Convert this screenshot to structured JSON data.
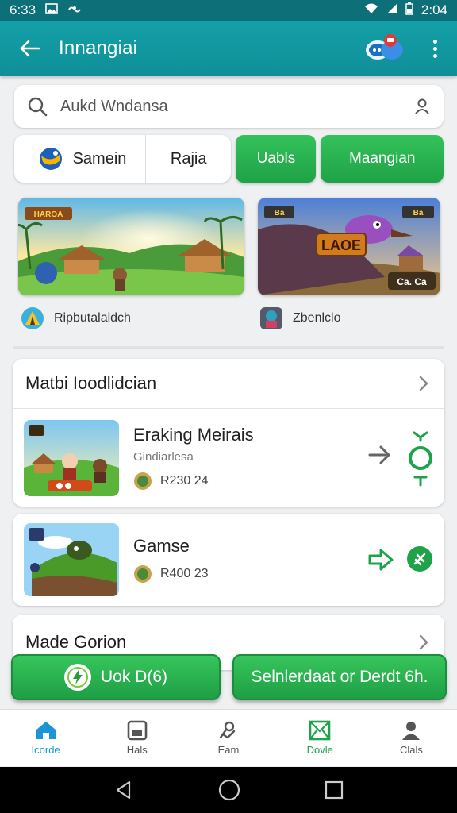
{
  "status_bar": {
    "time": "6:33",
    "battery_time": "2:04"
  },
  "app_bar": {
    "title": "Innangiai"
  },
  "search": {
    "placeholder": "Aukd Wndansa"
  },
  "chips": {
    "chip1": "Samein",
    "chip2": "Rajia",
    "chip3": "Uabls",
    "chip4": "Maangian"
  },
  "featured": {
    "card1": {
      "badge": "HAROA",
      "label": "Ripbutalaldch"
    },
    "card2": {
      "badge_left": "Ba",
      "badge_right": "Ba",
      "sign": "LAOE",
      "corner": "Ca. Ca",
      "label": "Zbenlclo"
    }
  },
  "section1": {
    "title": "Matbi Ioodlidcian",
    "row": {
      "title": "Eraking Meirais",
      "subtitle": "Gindiarlesa",
      "price": "R230 24"
    }
  },
  "section2": {
    "row": {
      "title": "Gamse",
      "price": "R400 23"
    }
  },
  "section3": {
    "title": "Made Gorion"
  },
  "cta": {
    "left_label": "Uok D(6)",
    "right_label": "Selnlerdaat or Derdt 6h."
  },
  "bottom_nav": [
    {
      "label": "Icorde",
      "icon": "home-icon"
    },
    {
      "label": "Hals",
      "icon": "store-icon"
    },
    {
      "label": "Eam",
      "icon": "tools-icon"
    },
    {
      "label": "Dovle",
      "icon": "mail-icon"
    },
    {
      "label": "Clals",
      "icon": "profile-icon"
    }
  ],
  "colors": {
    "primary": "#14a0a8",
    "accent_green": "#22a84a",
    "active_nav": "#1b95d8"
  }
}
